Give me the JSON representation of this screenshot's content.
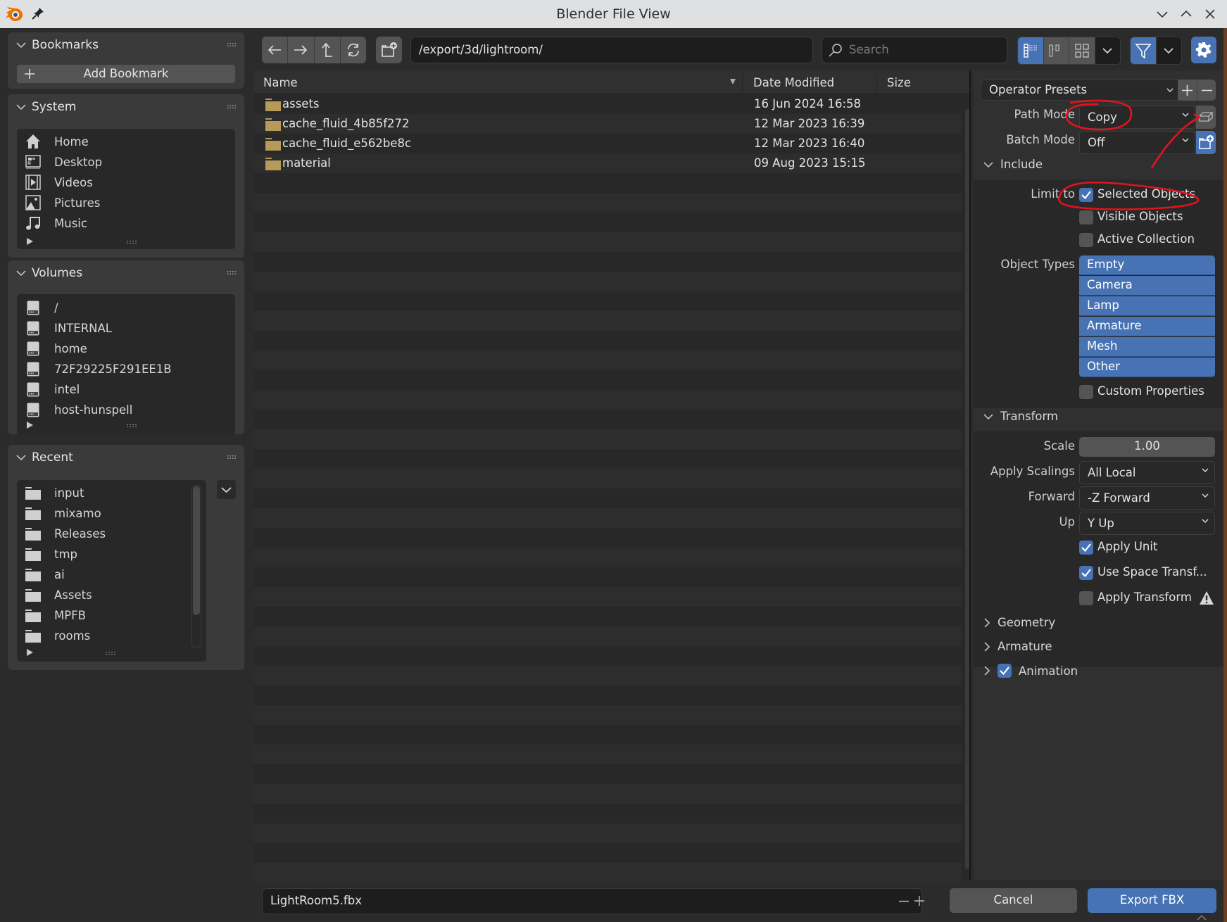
{
  "window": {
    "title": "Blender File View",
    "controls": [
      "minimize",
      "maximize",
      "close"
    ]
  },
  "sidebar": {
    "bookmarks": {
      "title": "Bookmarks",
      "add_label": "Add Bookmark"
    },
    "system": {
      "title": "System",
      "items": [
        {
          "label": "Home",
          "icon": "home-icon"
        },
        {
          "label": "Desktop",
          "icon": "desktop-icon"
        },
        {
          "label": "Videos",
          "icon": "film-icon"
        },
        {
          "label": "Pictures",
          "icon": "image-icon"
        },
        {
          "label": "Music",
          "icon": "music-icon"
        }
      ]
    },
    "volumes": {
      "title": "Volumes",
      "items": [
        {
          "label": "/"
        },
        {
          "label": "INTERNAL"
        },
        {
          "label": "home"
        },
        {
          "label": "72F29225F291EE1B"
        },
        {
          "label": "intel"
        },
        {
          "label": "host-hunspell"
        }
      ]
    },
    "recent": {
      "title": "Recent",
      "items": [
        {
          "label": "input"
        },
        {
          "label": "mixamo"
        },
        {
          "label": "Releases"
        },
        {
          "label": "tmp"
        },
        {
          "label": "ai"
        },
        {
          "label": "Assets"
        },
        {
          "label": "MPFB"
        },
        {
          "label": "rooms"
        }
      ]
    }
  },
  "toolbar": {
    "path": "/export/3d/lightroom/",
    "search_placeholder": "Search",
    "display_mode": "vertical-list",
    "filter_enabled": true
  },
  "file_list": {
    "columns": [
      "Name",
      "Date Modified",
      "Size"
    ],
    "sort_column": "Name",
    "rows": [
      {
        "name": "assets",
        "date": "16 Jun 2024 16:58",
        "size": ""
      },
      {
        "name": "cache_fluid_4b85f272",
        "date": "12 Mar 2023 16:39",
        "size": ""
      },
      {
        "name": "cache_fluid_e562be8c",
        "date": "12 Mar 2023 16:40",
        "size": ""
      },
      {
        "name": "material",
        "date": "09 Aug 2023 15:15",
        "size": ""
      }
    ]
  },
  "settings": {
    "operator_presets": "Operator Presets",
    "path_mode": {
      "label": "Path Mode",
      "value": "Copy"
    },
    "batch_mode": {
      "label": "Batch Mode",
      "value": "Off"
    },
    "include": {
      "title": "Include",
      "limit_to_label": "Limit to",
      "limit_to": [
        {
          "label": "Selected Objects",
          "checked": true
        },
        {
          "label": "Visible Objects",
          "checked": false
        },
        {
          "label": "Active Collection",
          "checked": false
        }
      ],
      "object_types_label": "Object Types",
      "object_types": [
        "Empty",
        "Camera",
        "Lamp",
        "Armature",
        "Mesh",
        "Other"
      ],
      "custom_properties": {
        "label": "Custom Properties",
        "checked": false
      }
    },
    "transform": {
      "title": "Transform",
      "scale": {
        "label": "Scale",
        "value": "1.00"
      },
      "apply_scalings": {
        "label": "Apply Scalings",
        "value": "All Local"
      },
      "forward": {
        "label": "Forward",
        "value": "-Z Forward"
      },
      "up": {
        "label": "Up",
        "value": "Y Up"
      },
      "apply_unit": {
        "label": "Apply Unit",
        "checked": true
      },
      "use_space_transform": {
        "label": "Use Space Transf...",
        "checked": true
      },
      "apply_transform": {
        "label": "Apply Transform",
        "checked": false
      }
    },
    "collapsed_sections": [
      {
        "label": "Geometry"
      },
      {
        "label": "Armature"
      },
      {
        "label": "Animation",
        "checked": true
      }
    ]
  },
  "footer": {
    "filename": "LightRoom5.fbx",
    "cancel_label": "Cancel",
    "export_label": "Export FBX"
  },
  "colors": {
    "accent": "#4772b3",
    "folder": "#b59a5a",
    "annotation": "#e0141e"
  }
}
